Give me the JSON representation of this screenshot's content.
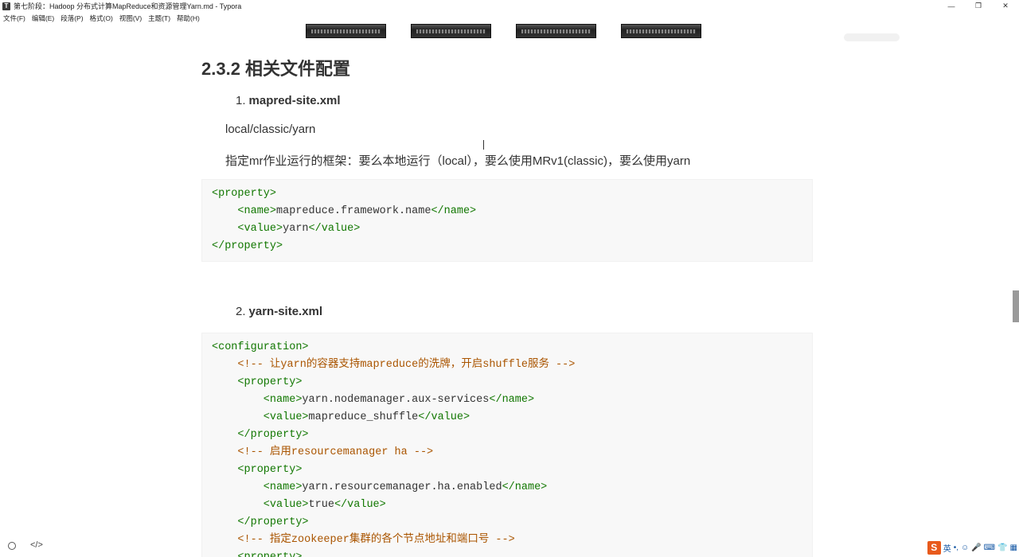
{
  "window": {
    "title": "第七阶段：Hadoop 分布式计算MapReduce和资源管理Yarn.md - Typora",
    "app_icon": "T"
  },
  "menu": [
    "文件(F)",
    "编辑(E)",
    "段落(P)",
    "格式(O)",
    "视图(V)",
    "主题(T)",
    "帮助(H)"
  ],
  "doc": {
    "heading": "2.3.2 相关文件配置",
    "item1": {
      "num": "1.",
      "label": "mapred-site.xml"
    },
    "para1": "local/classic/yarn",
    "para2": "指定mr作业运行的框架：要么本地运行（local），要么使用MRv1(classic)，要么使用yarn",
    "code1": [
      [
        "<property>"
      ],
      [
        "    <name>",
        "mapreduce.framework.name",
        "</name>"
      ],
      [
        "    <value>",
        "yarn",
        "</value>"
      ],
      [
        "</property>"
      ]
    ],
    "item2": {
      "num": "2.",
      "label": "yarn-site.xml"
    },
    "code2": [
      {
        "t": "tag",
        "s": "<configuration>"
      },
      {
        "t": "cmt",
        "s": "    <!-- 让yarn的容器支持mapreduce的洗牌，开启shuffle服务 -->"
      },
      {
        "t": "tag",
        "s": "    <property>"
      },
      {
        "t": "mix",
        "a": "        <name>",
        "b": "yarn.nodemanager.aux-services",
        "c": "</name>"
      },
      {
        "t": "mix",
        "a": "        <value>",
        "b": "mapreduce_shuffle",
        "c": "</value>"
      },
      {
        "t": "tag",
        "s": "    </property>"
      },
      {
        "t": "cmt",
        "s": "    <!-- 启用resourcemanager ha -->"
      },
      {
        "t": "tag",
        "s": "    <property>"
      },
      {
        "t": "mix",
        "a": "        <name>",
        "b": "yarn.resourcemanager.ha.enabled",
        "c": "</name>"
      },
      {
        "t": "mix",
        "a": "        <value>",
        "b": "true",
        "c": "</value>"
      },
      {
        "t": "tag",
        "s": "    </property>"
      },
      {
        "t": "cmt",
        "s": "    <!-- 指定zookeeper集群的各个节点地址和端口号 -->"
      },
      {
        "t": "tag",
        "s": "    <property>"
      }
    ]
  },
  "ime": {
    "logo": "S",
    "lang": "英"
  }
}
